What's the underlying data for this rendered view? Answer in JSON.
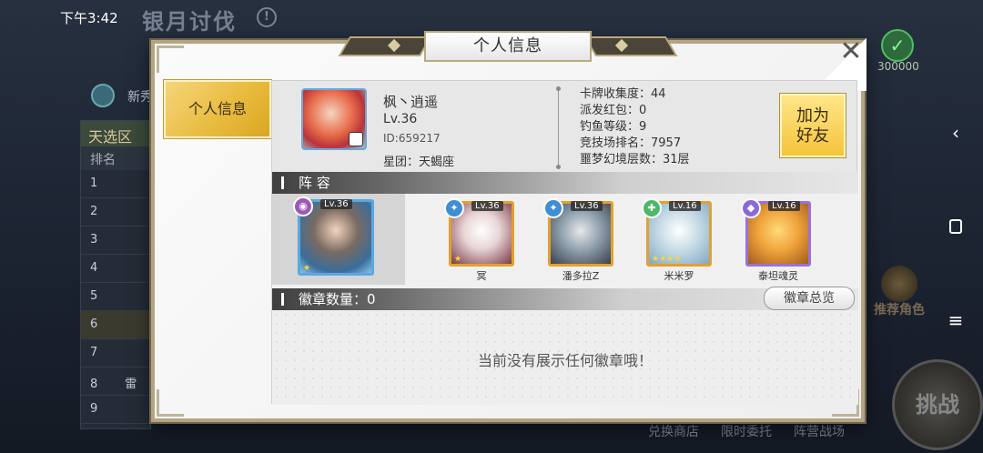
{
  "status_bar": {
    "time": "下午3:42"
  },
  "background": {
    "title": "银月讨伐",
    "left_label": "新秀",
    "rank_panel": {
      "heading": "天选区",
      "column": "排名",
      "rows": [
        "1",
        "2",
        "3",
        "4",
        "5",
        "6",
        "7",
        "8",
        "9"
      ],
      "row8_text": "雷"
    },
    "right_score": "300000",
    "right_recruit": "推荐角色",
    "right_challenge": "挑战",
    "bottom_links": [
      "兑换商店",
      "限时委托",
      "阵营战场"
    ]
  },
  "dialog": {
    "title": "个人信息",
    "side_tab": "个人信息",
    "profile": {
      "name": "枫丶逍遥",
      "level": "Lv.36",
      "id": "ID:659217",
      "guild": "星团：天蝎座"
    },
    "stats": [
      "卡牌收集度：44",
      "派发红包：0",
      "钓鱼等级：9",
      "竞技场排名：7957",
      "噩梦幻境层数：31层"
    ],
    "add_friend": [
      "加为",
      "好友"
    ],
    "lineup": {
      "title": "阵 容",
      "leader": {
        "level": "Lv.36",
        "element": "◉",
        "element_color": "#9b59b6",
        "stars": "★"
      },
      "cards": [
        {
          "level": "Lv.36",
          "name": "冥",
          "element": "✦",
          "element_color": "#3e8ed6",
          "stars": "★",
          "bg": "#e9d6d6"
        },
        {
          "level": "Lv.36",
          "name": "潘多拉Z",
          "element": "✦",
          "element_color": "#3e8ed6",
          "stars": "",
          "bg": "#8fa0ad"
        },
        {
          "level": "Lv.16",
          "name": "米米罗",
          "element": "✚",
          "element_color": "#4db86a",
          "stars": "★★★★",
          "bg": "#c7dbe6"
        },
        {
          "level": "Lv.16",
          "name": "泰坦魂灵",
          "element": "◆",
          "element_color": "#8a6ad6",
          "stars": "",
          "bg": "#f0a43c"
        }
      ]
    },
    "badges": {
      "title": "徽章数量：0",
      "overview_button": "徽章总览",
      "empty_text": "当前没有展示任何徽章哦！"
    }
  }
}
